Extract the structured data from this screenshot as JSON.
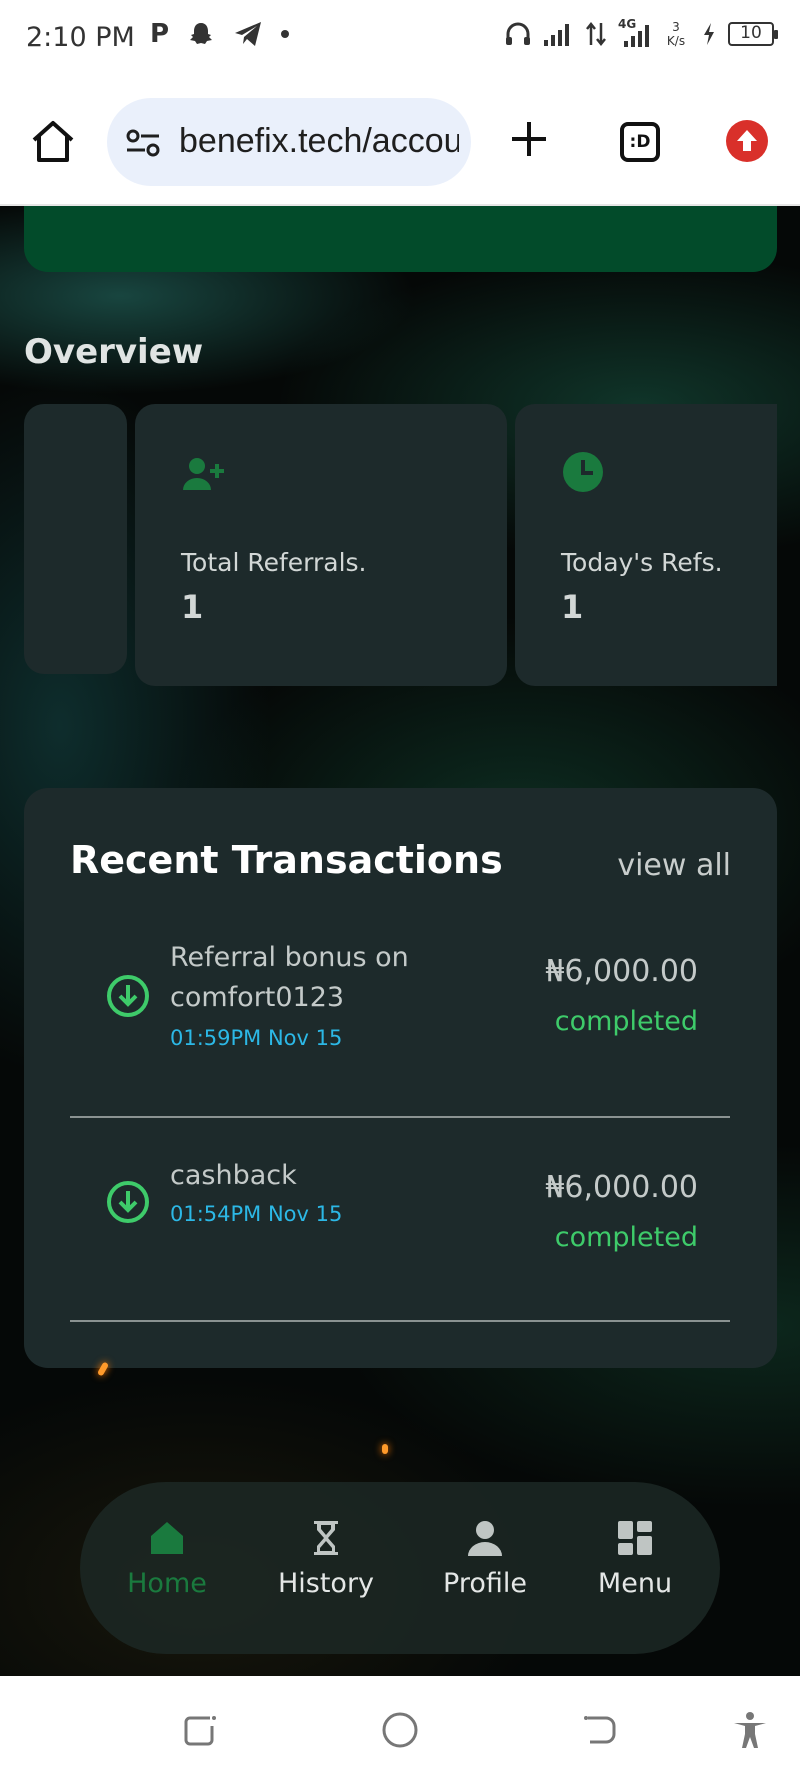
{
  "status_bar": {
    "time": "2:10 PM",
    "left_icons": [
      "p-app-icon",
      "snapchat-icon",
      "telegram-icon",
      "dot-icon"
    ],
    "network_label": "4G",
    "net_speed_value": "3",
    "net_speed_unit": "K/s",
    "battery_level": "10"
  },
  "browser": {
    "url": "benefix.tech/account",
    "tab_label": ":D"
  },
  "overview": {
    "title": "Overview",
    "cards": [
      {
        "label": "Total Referrals.",
        "value": "1",
        "icon": "add-user-icon"
      },
      {
        "label": "Today's Refs.",
        "value": "1",
        "icon": "clock-icon"
      }
    ]
  },
  "transactions": {
    "title": "Recent Transactions",
    "view_all": "view all",
    "items": [
      {
        "description": "Referral bonus on comfort0123",
        "time": "01:59PM Nov 15",
        "amount": "₦6,000.00",
        "status": "completed",
        "icon": "download-circle-icon"
      },
      {
        "description": "cashback",
        "time": "01:54PM Nov 15",
        "amount": "₦6,000.00",
        "status": "completed",
        "icon": "download-circle-icon"
      }
    ]
  },
  "bottom_nav": {
    "items": [
      {
        "label": "Home",
        "icon": "home-icon",
        "active": true
      },
      {
        "label": "History",
        "icon": "hourglass-icon",
        "active": false
      },
      {
        "label": "Profile",
        "icon": "person-icon",
        "active": false
      },
      {
        "label": "Menu",
        "icon": "grid-icon",
        "active": false
      }
    ]
  },
  "colors": {
    "accent_green": "#3ecb6a",
    "brand_dark_green": "#024b2a",
    "active_nav": "#1a7a3e",
    "time_blue": "#2cb8e6",
    "card_bg": "#1d2a2b"
  }
}
